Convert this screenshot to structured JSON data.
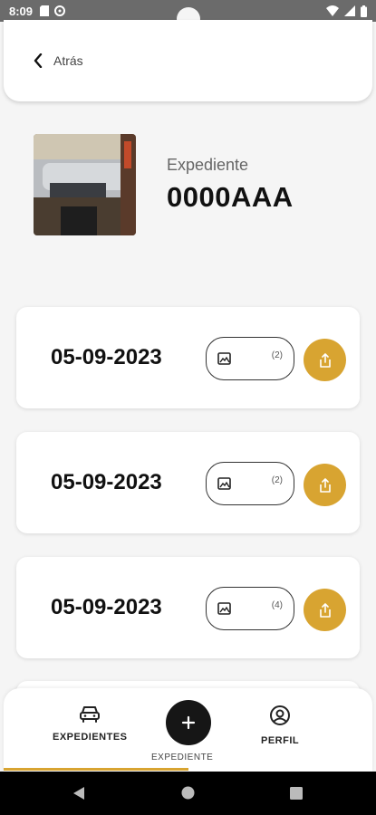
{
  "status_bar": {
    "time": "8:09"
  },
  "header": {
    "back_label": "Atrás"
  },
  "vehicle": {
    "label": "Expediente",
    "plate": "0000AAA"
  },
  "records": [
    {
      "date": "05-09-2023",
      "photo_count": "(2)"
    },
    {
      "date": "05-09-2023",
      "photo_count": "(2)"
    },
    {
      "date": "05-09-2023",
      "photo_count": "(4)"
    }
  ],
  "bottom_nav": {
    "expedientes": "EXPEDIENTES",
    "new_expediente": "EXPEDIENTE",
    "perfil": "PERFIL"
  },
  "colors": {
    "accent": "#d8a431",
    "dark": "#161616"
  }
}
